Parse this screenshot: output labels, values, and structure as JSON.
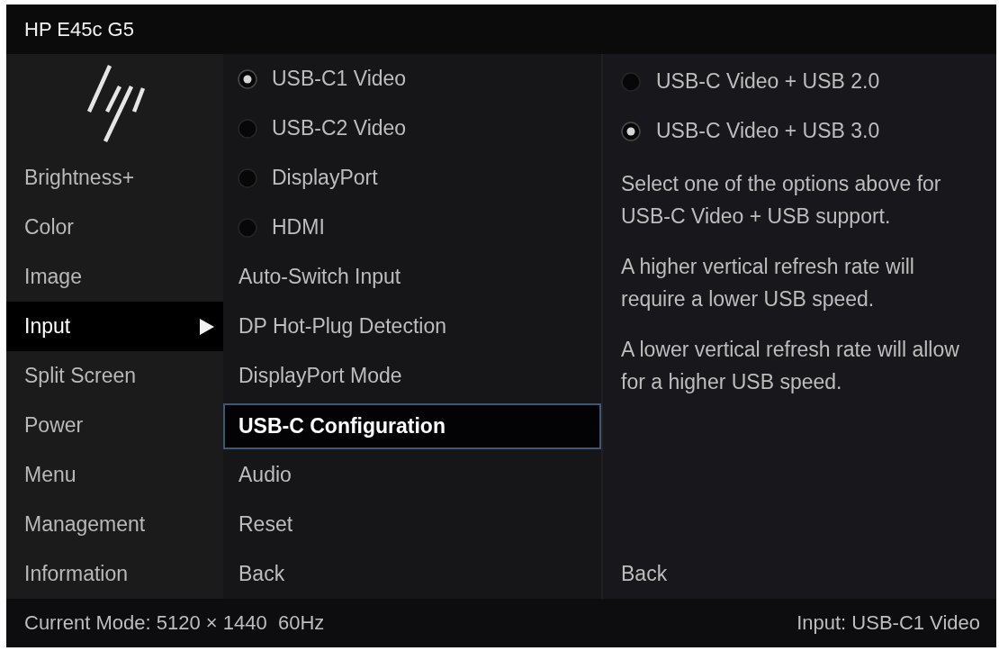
{
  "window": {
    "title": "HP E45c G5"
  },
  "sidebar": {
    "items": [
      {
        "label": "Brightness+",
        "selected": false
      },
      {
        "label": "Color",
        "selected": false
      },
      {
        "label": "Image",
        "selected": false
      },
      {
        "label": "Input",
        "selected": true
      },
      {
        "label": "Split Screen",
        "selected": false
      },
      {
        "label": "Power",
        "selected": false
      },
      {
        "label": "Menu",
        "selected": false
      },
      {
        "label": "Management",
        "selected": false
      },
      {
        "label": "Information",
        "selected": false
      }
    ]
  },
  "submenu": {
    "input_options": [
      {
        "label": "USB-C1 Video",
        "selected": true
      },
      {
        "label": "USB-C2 Video",
        "selected": false
      },
      {
        "label": "DisplayPort",
        "selected": false
      },
      {
        "label": "HDMI",
        "selected": false
      }
    ],
    "items": [
      {
        "label": "Auto-Switch Input",
        "selected": false
      },
      {
        "label": "DP Hot-Plug Detection",
        "selected": false
      },
      {
        "label": "DisplayPort Mode",
        "selected": false
      },
      {
        "label": "USB-C Configuration",
        "selected": true
      },
      {
        "label": "Audio",
        "selected": false
      },
      {
        "label": "Reset",
        "selected": false
      },
      {
        "label": "Back",
        "selected": false
      }
    ]
  },
  "detail": {
    "options": [
      {
        "label": "USB-C Video + USB 2.0",
        "selected": false
      },
      {
        "label": "USB-C Video + USB 3.0",
        "selected": true
      }
    ],
    "paragraphs": [
      "Select one of the options above for USB-C Video + USB support.",
      "A higher vertical refresh rate will require a lower USB speed.",
      "A lower vertical refresh rate will allow for a higher USB speed."
    ],
    "back": "Back"
  },
  "status_bar": {
    "mode": "Current Mode: 5120 × 1440  60Hz",
    "input": "Input: USB-C1 Video"
  }
}
